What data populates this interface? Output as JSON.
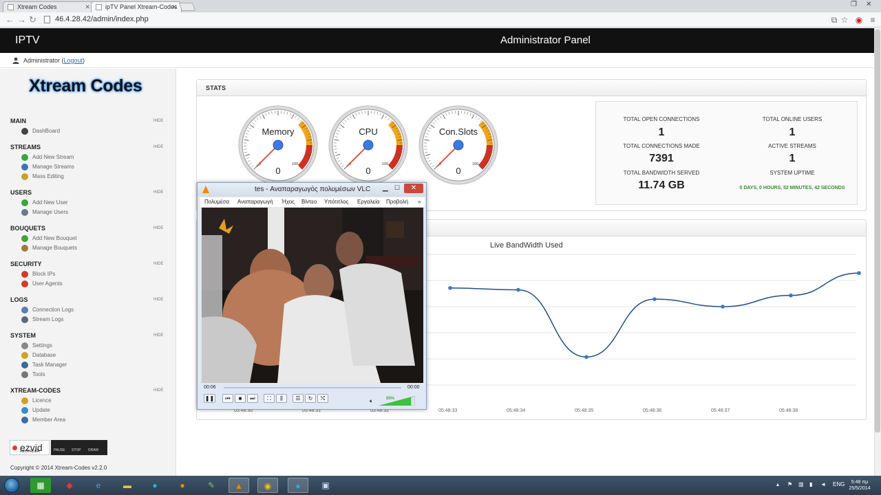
{
  "browser": {
    "tabs": [
      {
        "label": "Xtream Codes",
        "active": false
      },
      {
        "label": "ipTV Panel Xtream-Codes",
        "active": true
      }
    ],
    "url": "46.4.28.42/admin/index.php"
  },
  "app": {
    "brand": "IPTV",
    "title": "Administrator Panel",
    "user": "Administrator",
    "logout": "Logout"
  },
  "sidebar": {
    "logo": "Xtream Codes",
    "hide_label": "HIDE",
    "sections": [
      {
        "title": "MAIN",
        "items": [
          {
            "label": "DashBoard",
            "icon": "dashboard-icon",
            "color": "#444444"
          }
        ]
      },
      {
        "title": "STREAMS",
        "items": [
          {
            "label": "Add New Stream",
            "icon": "add-icon",
            "color": "#3aa53a"
          },
          {
            "label": "Manage Streams",
            "icon": "streams-icon",
            "color": "#3b73b9"
          },
          {
            "label": "Mass Editing",
            "icon": "edit-icon",
            "color": "#c9a227"
          }
        ]
      },
      {
        "title": "USERS",
        "items": [
          {
            "label": "Add New User",
            "icon": "add-user-icon",
            "color": "#3aa53a"
          },
          {
            "label": "Manage Users",
            "icon": "users-icon",
            "color": "#6a7a8a"
          }
        ]
      },
      {
        "title": "BOUQUETS",
        "items": [
          {
            "label": "Add New Bouquet",
            "icon": "add-icon",
            "color": "#3aa53a"
          },
          {
            "label": "Manage Bouquets",
            "icon": "bouquet-icon",
            "color": "#a07a3a"
          }
        ]
      },
      {
        "title": "SECURITY",
        "items": [
          {
            "label": "Block IPs",
            "icon": "block-icon",
            "color": "#d33a2a"
          },
          {
            "label": "User Agents",
            "icon": "agent-icon",
            "color": "#d33a2a"
          }
        ]
      },
      {
        "title": "LOGS",
        "items": [
          {
            "label": "Connection Logs",
            "icon": "logs-icon",
            "color": "#5a7fb0"
          },
          {
            "label": "Stream Logs",
            "icon": "stream-logs-icon",
            "color": "#5a6a7a"
          }
        ]
      },
      {
        "title": "SYSTEM",
        "items": [
          {
            "label": "Settings",
            "icon": "gear-icon",
            "color": "#888888"
          },
          {
            "label": "Database",
            "icon": "database-icon",
            "color": "#d1a21f"
          },
          {
            "label": "Task Manager",
            "icon": "task-icon",
            "color": "#3a6a9a"
          },
          {
            "label": "Tools",
            "icon": "tools-icon",
            "color": "#777777"
          }
        ]
      },
      {
        "title": "XTREAM-CODES",
        "items": [
          {
            "label": "Licence",
            "icon": "key-icon",
            "color": "#d1a21f"
          },
          {
            "label": "Update",
            "icon": "update-icon",
            "color": "#3a8ad0"
          },
          {
            "label": "Member Area",
            "icon": "member-icon",
            "color": "#3a6ab0"
          }
        ]
      }
    ],
    "recorder": {
      "brand": "ezvid",
      "sub": "RECORDER",
      "buttons": [
        "PAUSE",
        "STOP",
        "DRAW"
      ]
    },
    "copyright": "Copyright © 2014 Xtream-Codes v2.2.0"
  },
  "stats": {
    "title": "STATS",
    "gauges": [
      {
        "label": "Memory",
        "value": 0,
        "min": "0",
        "max": "100"
      },
      {
        "label": "CPU",
        "value": 0,
        "min": "0",
        "max": "100"
      },
      {
        "label": "Con.Slots",
        "value": 0,
        "min": "0",
        "max": "100"
      }
    ],
    "cells": [
      {
        "label": "TOTAL OPEN CONNECTIONS",
        "value": "1"
      },
      {
        "label": "TOTAL ONLINE USERS",
        "value": "1"
      },
      {
        "label": "TOTAL CONNECTIONS MADE",
        "value": "7391"
      },
      {
        "label": "ACTIVE STREAMS",
        "value": "1"
      },
      {
        "label": "TOTAL BANDWIDTH SERVED",
        "value": "11.74 GB"
      },
      {
        "label": "SYSTEM UPTIME",
        "value": "0 DAYS, 0 HOURS, 52 MINUTES, 42 SECONDS"
      }
    ]
  },
  "chart_data": {
    "type": "line",
    "title": "Live BandWidth Used",
    "x": [
      "05:48:30",
      "05:48:31",
      "05:48:32",
      "05:48:33",
      "05:48:34",
      "05:48:35",
      "05:48:36",
      "05:48:37",
      "05:48:38",
      "05:48:39"
    ],
    "values": [
      null,
      null,
      null,
      5.2,
      5.1,
      1.5,
      4.6,
      4.2,
      4.8,
      6.0
    ],
    "ylim": [
      0,
      7
    ],
    "grid": true,
    "color": "#1c4f8a"
  },
  "vlc": {
    "title": "tes - Αναπαραγωγός πολυμέσων VLC",
    "menu": [
      "Πολυμέσα",
      "Αναπαραγωγή",
      "Ήχος",
      "Βίντεο",
      "Υπότιτλος",
      "Εργαλεία",
      "Προβολή",
      "»"
    ],
    "time_current": "00:06",
    "time_total": "00:00",
    "volume": "89%",
    "volume_fraction": 0.89
  },
  "taskbar": {
    "lang": "ENG",
    "time": "5:48 πμ",
    "date": "25/5/2014"
  }
}
